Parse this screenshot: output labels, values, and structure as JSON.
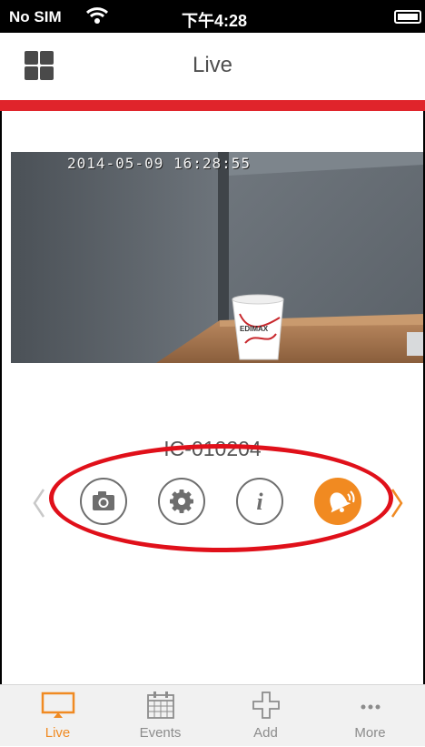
{
  "status_bar": {
    "carrier": "No SIM",
    "time": "下午4:28"
  },
  "navbar": {
    "title": "Live"
  },
  "camera": {
    "timestamp": "2014-05-09 16:28:55",
    "cup_text": "EDIMAX"
  },
  "device": {
    "name": "IC-010204"
  },
  "actions": [
    {
      "name": "snapshot",
      "icon": "camera-icon"
    },
    {
      "name": "settings",
      "icon": "gear-icon"
    },
    {
      "name": "info",
      "icon": "info-icon"
    },
    {
      "name": "alert",
      "icon": "bell-icon"
    }
  ],
  "tabs": [
    {
      "label": "Live",
      "icon": "monitor-icon",
      "active": true
    },
    {
      "label": "Events",
      "icon": "calendar-icon",
      "active": false
    },
    {
      "label": "Add",
      "icon": "plus-icon",
      "active": false
    },
    {
      "label": "More",
      "icon": "more-dots-icon",
      "active": false
    }
  ],
  "colors": {
    "accent": "#f08a22",
    "red_bar": "#e0242b",
    "highlight_ellipse": "#e0101a"
  }
}
